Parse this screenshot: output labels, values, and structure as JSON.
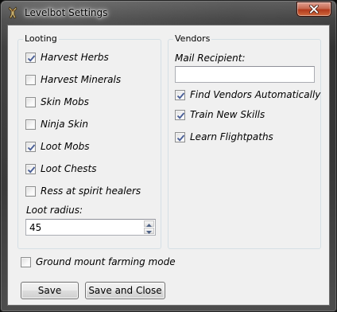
{
  "window": {
    "title": "Levelbot Settings",
    "icons": {
      "app": "levelbot-app-icon",
      "close": "close-x-icon"
    },
    "close_button_color": "#c74a2c"
  },
  "looting": {
    "legend": "Looting",
    "options": [
      {
        "label": "Harvest Herbs",
        "checked": true
      },
      {
        "label": "Harvest Minerals",
        "checked": false
      },
      {
        "label": "Skin Mobs",
        "checked": false
      },
      {
        "label": "Ninja Skin",
        "checked": false
      },
      {
        "label": "Loot Mobs",
        "checked": true
      },
      {
        "label": "Loot Chests",
        "checked": true
      },
      {
        "label": "Ress at spirit healers",
        "checked": false
      }
    ],
    "loot_radius_label": "Loot radius:",
    "loot_radius_value": "45"
  },
  "vendors": {
    "legend": "Vendors",
    "mail_recipient_label": "Mail Recipient:",
    "mail_recipient_value": "",
    "options": [
      {
        "label": "Find Vendors Automatically",
        "checked": true
      },
      {
        "label": "Train New Skills",
        "checked": true
      },
      {
        "label": "Learn Flightpaths",
        "checked": true
      }
    ]
  },
  "ground_mount": {
    "label": "Ground mount farming mode",
    "checked": false
  },
  "buttons": {
    "save": "Save",
    "save_and_close": "Save and Close"
  },
  "colors": {
    "client_bg": "#f0f0f0",
    "checkmark": "#4a5f97",
    "group_border": "#d5dfe5"
  }
}
